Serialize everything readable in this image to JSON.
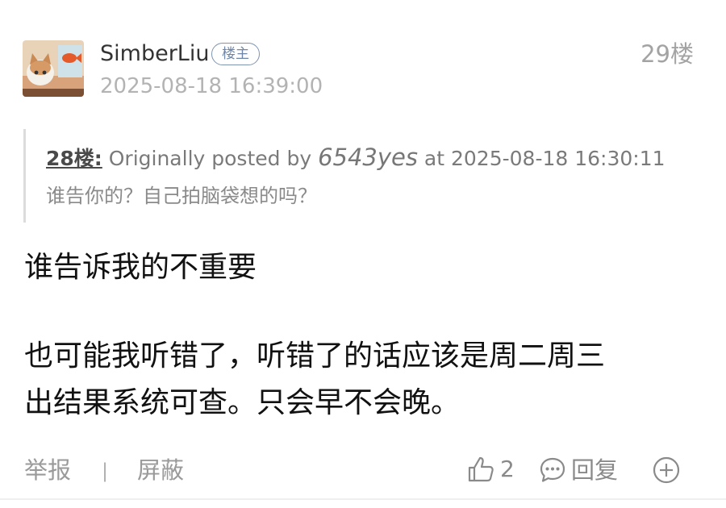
{
  "post": {
    "author": {
      "username": "SimberLiu",
      "badge": "楼主",
      "avatar": "cat-with-goldfish-avatar"
    },
    "floor": "29楼",
    "timestamp": "2025-08-18 16:39:00",
    "quote": {
      "ref": "28楼:",
      "prefix": " Originally posted by ",
      "author": "6543yes",
      "suffix": " at 2025-08-18 16:30:11",
      "text": "谁告你的？自己拍脑袋想的吗？"
    },
    "body": [
      "谁告诉我的不重要",
      "也可能我听错了，听错了的话应该是周二周三",
      "出结果系统可查。只会早不会晚。"
    ]
  },
  "footer": {
    "report_label": "举报",
    "separator": "|",
    "block_label": "屏蔽",
    "like_count": "2",
    "reply_label": "回复",
    "icons": {
      "like": "thumbs-up-icon",
      "comment": "comment-bubble-icon",
      "more": "plus-circle-icon"
    }
  },
  "colors": {
    "badge_border": "#7f94b0",
    "muted_text": "#a3a3a3",
    "body_text": "#111111"
  }
}
